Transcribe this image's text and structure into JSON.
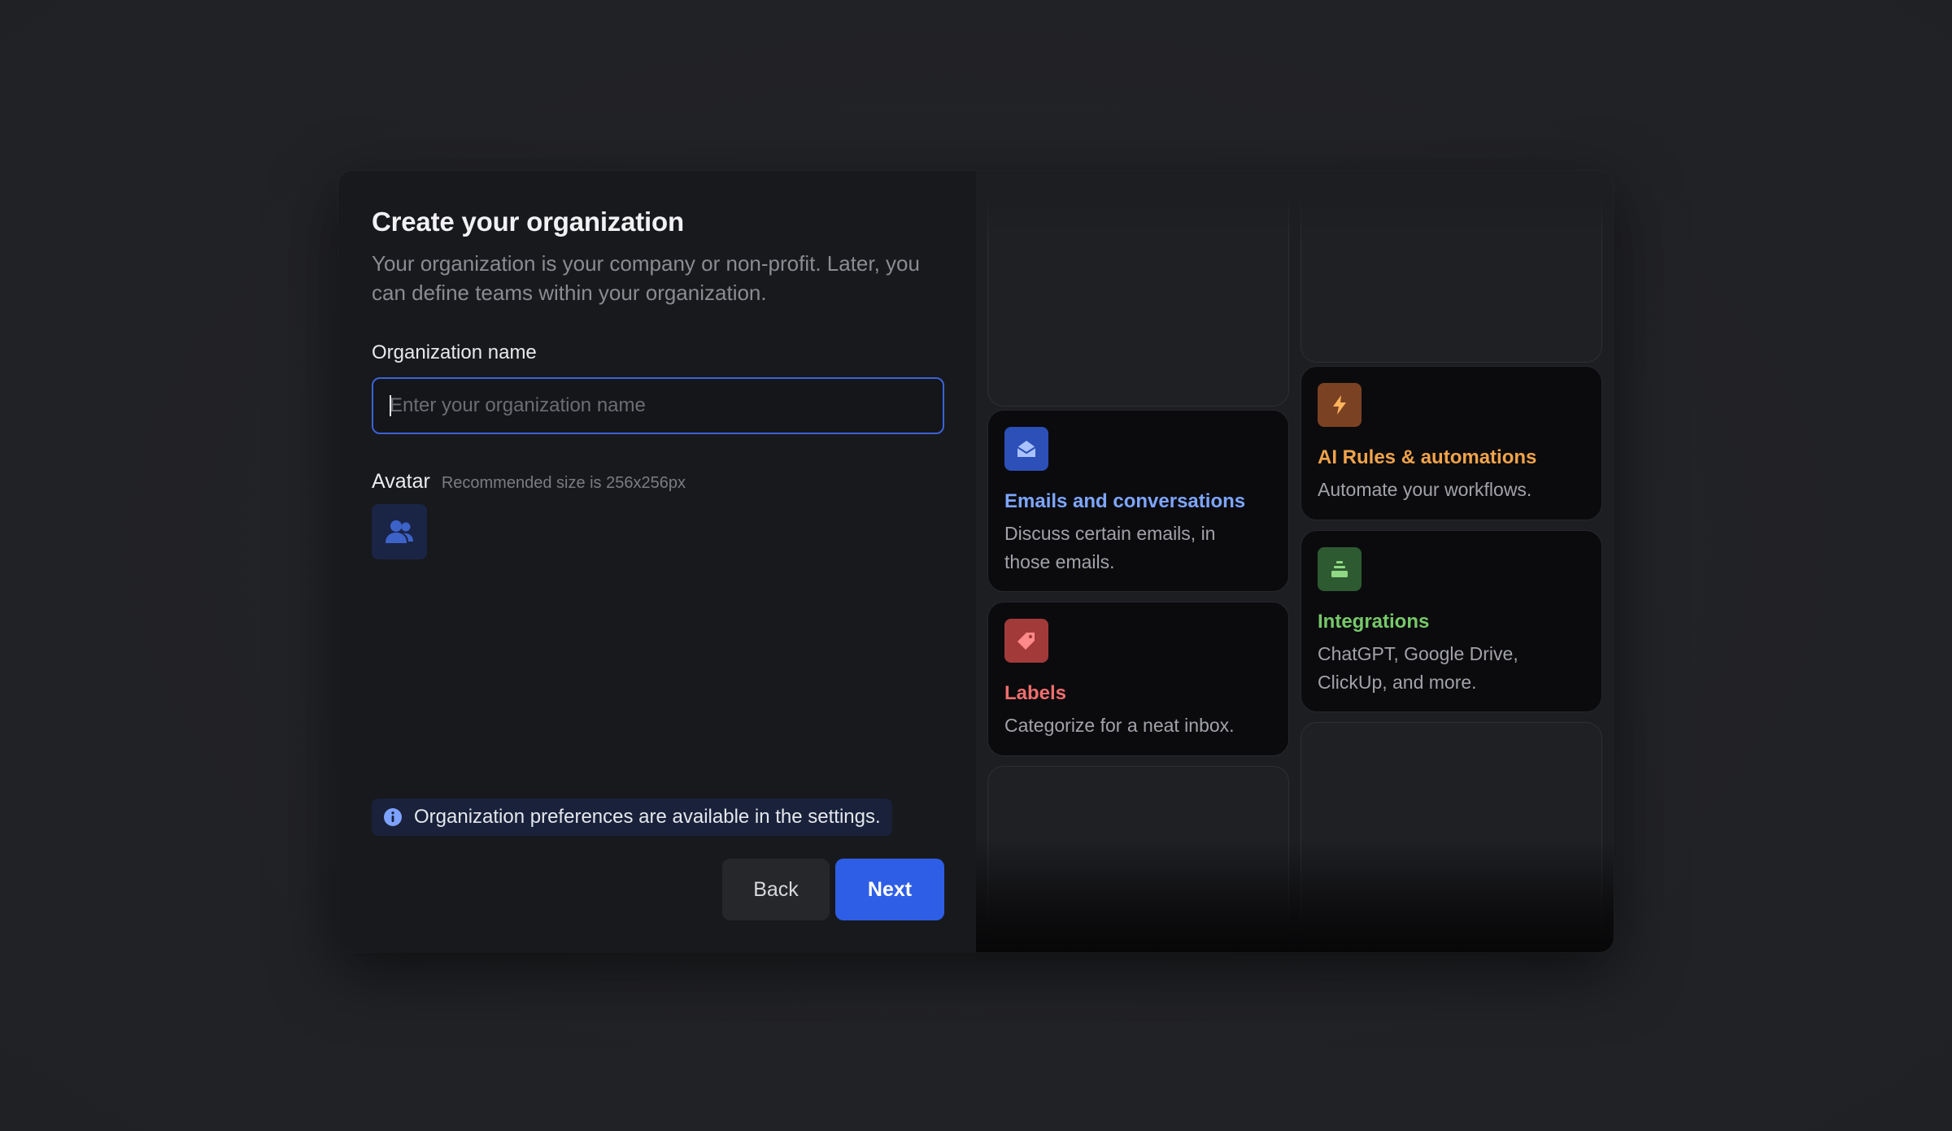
{
  "form": {
    "title": "Create your organization",
    "subtitle": "Your organization is your company or non-profit. Later, you can define teams within your organization.",
    "org_name_label": "Organization name",
    "org_name_placeholder": "Enter your organization name",
    "org_name_value": "",
    "avatar_label": "Avatar",
    "avatar_hint": "Recommended size is 256x256px",
    "avatar_icon": "users-icon",
    "info_text": "Organization preferences are available in the settings.",
    "info_icon": "info-icon",
    "back_label": "Back",
    "next_label": "Next",
    "accent_color": "#2f5ee6"
  },
  "features": [
    {
      "title": "Emails and conversations",
      "description": "Discuss certain emails, in those emails.",
      "icon": "envelope-open-icon",
      "color": "#7ea6ff"
    },
    {
      "title": "Labels",
      "description": "Categorize for a neat inbox.",
      "icon": "tag-icon",
      "color": "#ef6e6e"
    },
    {
      "title": "AI Rules & automations",
      "description": "Automate your workflows.",
      "icon": "bolt-icon",
      "color": "#f0a34a"
    },
    {
      "title": "Integrations",
      "description": "ChatGPT, Google Drive, ClickUp, and more.",
      "icon": "stack-icon",
      "color": "#77c86a"
    }
  ]
}
